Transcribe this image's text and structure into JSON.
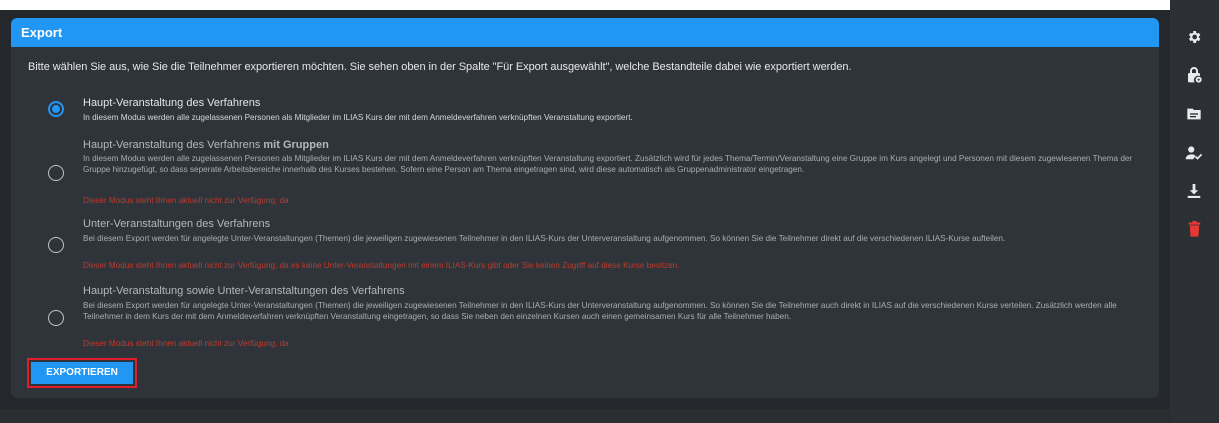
{
  "panel": {
    "title": "Export",
    "intro": "Bitte wählen Sie aus, wie Sie die Teilnehmer exportieren möchten. Sie sehen oben in der Spalte \"Für Export ausgewählt\", welche Bestandteile dabei wie exportiert werden."
  },
  "options": [
    {
      "title": "Haupt-Veranstaltung des Verfahrens",
      "description": "In diesem Modus werden alle zugelassenen Personen als Mitglieder im ILIAS Kurs der mit dem Anmeldeverfahren verknüpften Veranstaltung exportiert.",
      "note": "",
      "checked": true
    },
    {
      "title": "Haupt-Veranstaltung des Verfahrens",
      "title_bold": "mit Gruppen",
      "description": "In diesem Modus werden alle zugelassenen Personen als Mitglieder im ILIAS Kurs der mit dem Anmeldeverfahren verknüpften Veranstaltung exportiert. Zusätzlich wird für jedes Thema/Termin/Veranstaltung eine Gruppe im Kurs angelegt und Personen mit diesem zugewiesenen Thema der Gruppe hinzugefügt, so dass seperate Arbeitsbereiche innerhalb des Kurses bestehen. Sofern eine Person am Thema eingetragen sind, wird diese automatisch als Gruppenadministrator eingetragen.",
      "note": "Dieser Modus steht Ihnen aktuell nicht zur Verfügung, da",
      "checked": false
    },
    {
      "title": "Unter-Veranstaltungen des Verfahrens",
      "description": "Bei diesem Export werden für angelegte Unter-Veranstaltungen (Themen) die jeweiligen zugewiesenen Teilnehmer in den ILIAS-Kurs der Unterveranstaltung aufgenommen. So können Sie die Teilnehmer direkt auf die verschiedenen ILIAS-Kurse aufteilen.",
      "note": "Dieser Modus steht Ihnen aktuell nicht zur Verfügung, da es keine Unter-Veranstaltungen mit einem ILIAS-Kurs gibt oder Sie keinen Zugriff auf diese Kurse besitzen.",
      "checked": false
    },
    {
      "title": "Haupt-Veranstaltung sowie Unter-Veranstaltungen des Verfahrens",
      "description": "Bei diesem Export werden für angelegte Unter-Veranstaltungen (Themen) die jeweiligen zugewiesenen Teilnehmer in den ILIAS-Kurs der Unterveranstaltung aufgenommen. So können Sie die Teilnehmer auch direkt in ILIAS auf die verschiedenen Kurse verteilen. Zusätzlich werden alle Teilnehmer in dem Kurs der mit dem Anmeldeverfahren verknüpften Veranstaltung eingetragen, so dass Sie neben den einzelnen Kursen auch einen gemeinsamen Kurs für alle Teilnehmer haben.",
      "note": "Dieser Modus steht Ihnen aktuell nicht zur Verfügung, da",
      "checked": false
    }
  ],
  "export_button": "EXPORTIEREN",
  "sidebar": {
    "icons": [
      "gear-icon",
      "lock-gear-icon",
      "folder-icon",
      "user-check-icon",
      "download-icon",
      "trash-icon"
    ]
  },
  "colors": {
    "accent": "#2196f3",
    "danger": "#e53935",
    "note": "#c0392b"
  }
}
